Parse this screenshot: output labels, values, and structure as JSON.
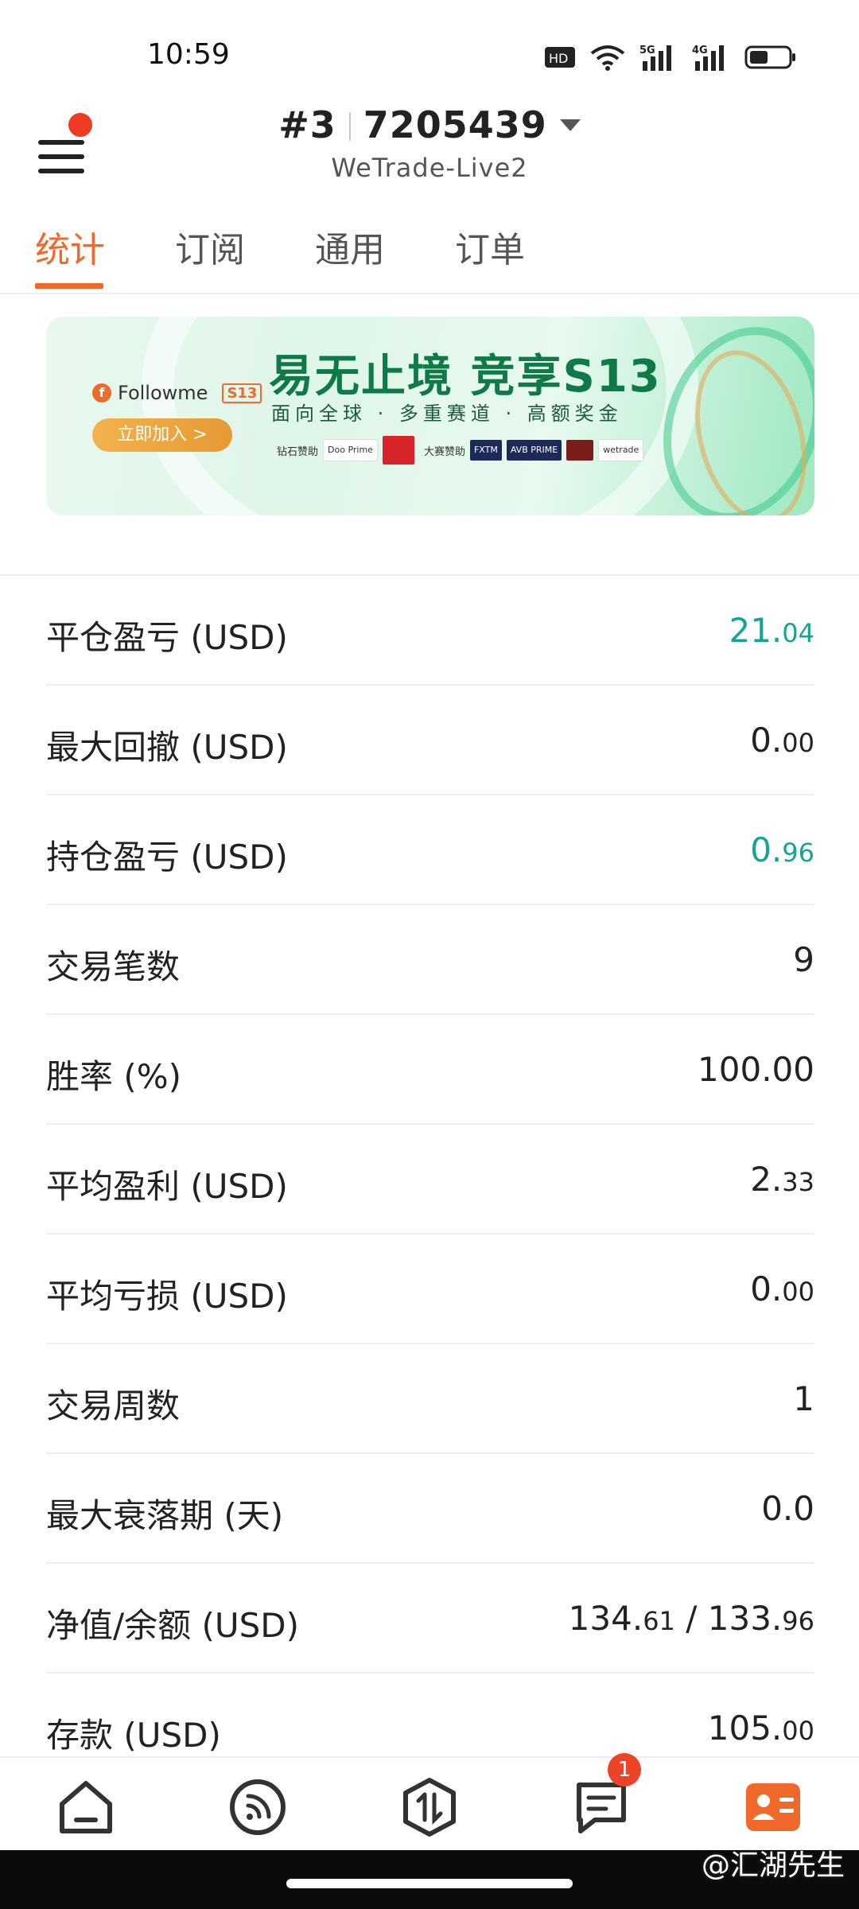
{
  "status_bar": {
    "time": "10:59",
    "hd_label": "HD",
    "net1": "5G",
    "net2": "4G"
  },
  "header": {
    "account_index": "#3",
    "account_number": "7205439",
    "server": "WeTrade-Live2"
  },
  "tabs": [
    {
      "label": "统计",
      "active": true
    },
    {
      "label": "订阅",
      "active": false
    },
    {
      "label": "通用",
      "active": false
    },
    {
      "label": "订单",
      "active": false
    }
  ],
  "banner": {
    "brand": "Followme",
    "brand_badge": "S13",
    "title": "易无止境 竞享S13",
    "subtitle": "面向全球 · 多重赛道 · 高额奖金",
    "join_button": "立即加入 >",
    "sponsor_label_1": "钻石赞助",
    "sponsor_label_2": "大赛赞助",
    "sponsors": [
      "Doo Prime",
      "FXTM",
      "AVB PRIME",
      "wetrade"
    ]
  },
  "stats": [
    {
      "label": "平仓盈亏 (USD)",
      "int": "21.",
      "dec": "04",
      "positive": true
    },
    {
      "label": "最大回撤 (USD)",
      "int": "0.",
      "dec": "00",
      "positive": false
    },
    {
      "label": "持仓盈亏 (USD)",
      "int": "0.",
      "dec": "96",
      "positive": true
    },
    {
      "label": "交易笔数",
      "int": "9",
      "dec": "",
      "positive": false
    },
    {
      "label": "胜率 (%)",
      "int": "100.00",
      "dec": "",
      "positive": false
    },
    {
      "label": "平均盈利 (USD)",
      "int": "2.",
      "dec": "33",
      "positive": false
    },
    {
      "label": "平均亏损 (USD)",
      "int": "0.",
      "dec": "00",
      "positive": false
    },
    {
      "label": "交易周数",
      "int": "1",
      "dec": "",
      "positive": false
    },
    {
      "label": "最大衰落期 (天)",
      "int": "0.0",
      "dec": "",
      "positive": false
    },
    {
      "label": "净值/余额 (USD)",
      "int": "134.",
      "dec": "61",
      "int2": " / 133.",
      "dec2": "96",
      "positive": false
    },
    {
      "label": "存款 (USD)",
      "int": "105.",
      "dec": "00",
      "positive": false
    }
  ],
  "bottom_nav": {
    "messages_badge": "1"
  },
  "watermark": "@汇湖先生",
  "colors": {
    "accent": "#f0692a",
    "positive": "#16a394",
    "badge": "#ef4328"
  }
}
